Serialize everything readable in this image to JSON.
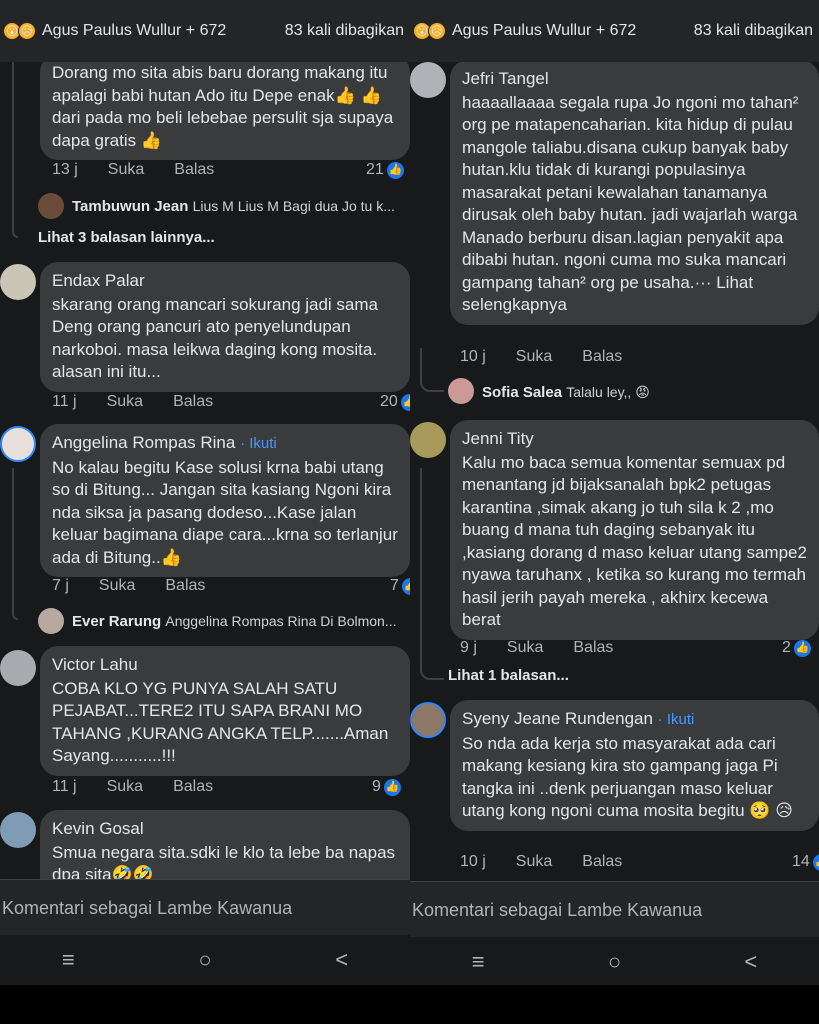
{
  "left": {
    "topbar": {
      "names": "Agus Paulus Wullur + 672",
      "shares": "83 kali dibagikan"
    },
    "comments": [
      {
        "text": "Dorang mo sita abis baru dorang makang itu apalagi babi hutan Ado itu Depe enak👍 👍 dari pada mo beli lebebae  persulit sja supaya dapa gratis 👍",
        "time": "13 j",
        "like": "Suka",
        "reply": "Balas",
        "reacts": "21"
      },
      {
        "reply_author": "Tambuwun Jean",
        "reply_text": "Lius M Lius M Bagi dua Jo tu k..."
      },
      {
        "more": "Lihat 3 balasan lainnya..."
      },
      {
        "author": "Endax Palar",
        "text": "skarang orang mancari sokurang jadi sama Deng orang pancuri ato penyelundupan narkoboi. masa leikwa daging kong mosita. alasan ini itu...",
        "time": "11 j",
        "like": "Suka",
        "reply": "Balas",
        "reacts": "20"
      },
      {
        "author": "Anggelina Rompas Rina",
        "follow": "· Ikuti",
        "text": "No kalau begitu Kase solusi krna babi utang so di Bitung... Jangan sita kasiang Ngoni kira nda siksa ja pasang dodeso...Kase jalan keluar bagimana diape cara...krna so terlanjur ada di Bitung..👍",
        "time": "7 j",
        "like": "Suka",
        "reply": "Balas",
        "reacts": "7"
      },
      {
        "reply_author": "Ever Rarung",
        "reply_text": "Anggelina Rompas Rina Di Bolmon..."
      },
      {
        "author": "Victor Lahu",
        "text": "COBA KLO YG PUNYA SALAH SATU PEJABAT...TERE2 ITU  SAPA BRANI MO TAHANG ,KURANG ANGKA TELP.......Aman Sayang...........!!!",
        "time": "11 j",
        "like": "Suka",
        "reply": "Balas",
        "reacts": "9"
      },
      {
        "author": "Kevin Gosal",
        "text": "Smua negara sita.sdki le klo ta lebe ba napas dpa sita🤣🤣"
      }
    ],
    "input_placeholder": "Komentari sebagai Lambe Kawanua"
  },
  "right": {
    "topbar": {
      "names": "Agus Paulus Wullur + 672",
      "shares": "83 kali dibagikan"
    },
    "comments": [
      {
        "author": "Jefri Tangel",
        "text": "haaaallaaaa segala rupa Jo ngoni mo tahan² org pe matapencaharian. kita hidup di pulau mangole taliabu.disana cukup banyak baby hutan.klu tidak di kurangi populasinya masarakat petani kewalahan tanamanya dirusak oleh baby hutan. jadi wajarlah warga Manado berburu disan.lagian penyakit apa dibabi hutan. ngoni cuma mo suka mancari gampang tahan² org pe usaha.··· Lihat selengkapnya",
        "time": "10 j",
        "like": "Suka",
        "reply": "Balas"
      },
      {
        "reply_author": "Sofia Salea",
        "reply_text": "Talalu ley,, 😡"
      },
      {
        "author": "Jenni Tity",
        "text": "Kalu mo baca semua komentar semuax pd menantang jd bijaksanalah bpk2 petugas karantina ,simak akang jo tuh sila k 2 ,mo buang d mana tuh daging sebanyak itu ,kasiang dorang d maso keluar utang sampe2 nyawa taruhanx , ketika so kurang mo termah hasil jerih payah mereka , akhirx kecewa berat",
        "time": "9 j",
        "like": "Suka",
        "reply": "Balas",
        "reacts": "2"
      },
      {
        "more": "Lihat 1 balasan..."
      },
      {
        "author": "Syeny Jeane Rundengan",
        "follow": "· Ikuti",
        "text": "So nda ada kerja sto masyarakat ada cari makang kesiang kira sto gampang jaga Pi tangka ini ..denk perjuangan maso keluar utang kong ngoni cuma mosita begitu 🥺 😥",
        "time": "10 j",
        "like": "Suka",
        "reply": "Balas",
        "reacts": "14"
      }
    ],
    "input_placeholder": "Komentari sebagai Lambe Kawanua"
  },
  "navbar": {
    "icons": [
      "menu-icon",
      "home-circle-icon",
      "back-icon"
    ]
  },
  "colors": {
    "background": "#18191a",
    "bubble": "#3a3b3c",
    "accent": "#4599ff",
    "like": "#1877f2"
  }
}
